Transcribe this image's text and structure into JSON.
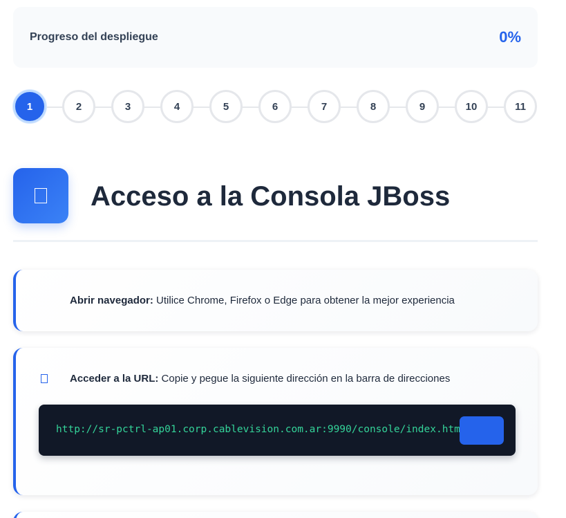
{
  "progress": {
    "label": "Progreso del despliegue",
    "value": "0%",
    "fraction": 0
  },
  "steps": {
    "items": [
      "1",
      "2",
      "3",
      "4",
      "5",
      "6",
      "7",
      "8",
      "9",
      "10",
      "11"
    ],
    "active": "1"
  },
  "header": {
    "title": "Acceso a la Consola JBoss",
    "icon": "document-icon"
  },
  "cards": [
    {
      "bold": "Abrir navegador:",
      "text": " Utilice Chrome, Firefox o Edge para obtener la mejor experiencia"
    },
    {
      "icon": "link-icon",
      "bold": "Acceder a la URL:",
      "text": " Copie y pegue la siguiente dirección en la barra de direcciones",
      "code": "http://sr-pctrl-ap01.corp.cablevision.com.ar:9990/console/index.html"
    }
  ],
  "colors": {
    "accent": "#2563eb",
    "code_background": "#111827",
    "code_text": "#34d399"
  }
}
